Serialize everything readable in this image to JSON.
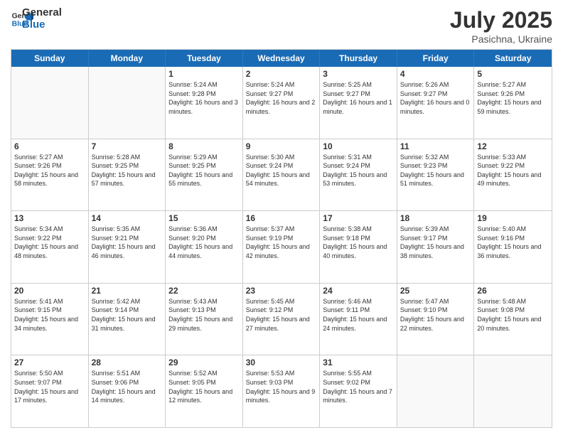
{
  "logo": {
    "line1": "General",
    "line2": "Blue"
  },
  "title": "July 2025",
  "subtitle": "Pasichna, Ukraine",
  "header_days": [
    "Sunday",
    "Monday",
    "Tuesday",
    "Wednesday",
    "Thursday",
    "Friday",
    "Saturday"
  ],
  "weeks": [
    [
      {
        "day": "",
        "sunrise": "",
        "sunset": "",
        "daylight": ""
      },
      {
        "day": "",
        "sunrise": "",
        "sunset": "",
        "daylight": ""
      },
      {
        "day": "1",
        "sunrise": "Sunrise: 5:24 AM",
        "sunset": "Sunset: 9:28 PM",
        "daylight": "Daylight: 16 hours and 3 minutes."
      },
      {
        "day": "2",
        "sunrise": "Sunrise: 5:24 AM",
        "sunset": "Sunset: 9:27 PM",
        "daylight": "Daylight: 16 hours and 2 minutes."
      },
      {
        "day": "3",
        "sunrise": "Sunrise: 5:25 AM",
        "sunset": "Sunset: 9:27 PM",
        "daylight": "Daylight: 16 hours and 1 minute."
      },
      {
        "day": "4",
        "sunrise": "Sunrise: 5:26 AM",
        "sunset": "Sunset: 9:27 PM",
        "daylight": "Daylight: 16 hours and 0 minutes."
      },
      {
        "day": "5",
        "sunrise": "Sunrise: 5:27 AM",
        "sunset": "Sunset: 9:26 PM",
        "daylight": "Daylight: 15 hours and 59 minutes."
      }
    ],
    [
      {
        "day": "6",
        "sunrise": "Sunrise: 5:27 AM",
        "sunset": "Sunset: 9:26 PM",
        "daylight": "Daylight: 15 hours and 58 minutes."
      },
      {
        "day": "7",
        "sunrise": "Sunrise: 5:28 AM",
        "sunset": "Sunset: 9:25 PM",
        "daylight": "Daylight: 15 hours and 57 minutes."
      },
      {
        "day": "8",
        "sunrise": "Sunrise: 5:29 AM",
        "sunset": "Sunset: 9:25 PM",
        "daylight": "Daylight: 15 hours and 55 minutes."
      },
      {
        "day": "9",
        "sunrise": "Sunrise: 5:30 AM",
        "sunset": "Sunset: 9:24 PM",
        "daylight": "Daylight: 15 hours and 54 minutes."
      },
      {
        "day": "10",
        "sunrise": "Sunrise: 5:31 AM",
        "sunset": "Sunset: 9:24 PM",
        "daylight": "Daylight: 15 hours and 53 minutes."
      },
      {
        "day": "11",
        "sunrise": "Sunrise: 5:32 AM",
        "sunset": "Sunset: 9:23 PM",
        "daylight": "Daylight: 15 hours and 51 minutes."
      },
      {
        "day": "12",
        "sunrise": "Sunrise: 5:33 AM",
        "sunset": "Sunset: 9:22 PM",
        "daylight": "Daylight: 15 hours and 49 minutes."
      }
    ],
    [
      {
        "day": "13",
        "sunrise": "Sunrise: 5:34 AM",
        "sunset": "Sunset: 9:22 PM",
        "daylight": "Daylight: 15 hours and 48 minutes."
      },
      {
        "day": "14",
        "sunrise": "Sunrise: 5:35 AM",
        "sunset": "Sunset: 9:21 PM",
        "daylight": "Daylight: 15 hours and 46 minutes."
      },
      {
        "day": "15",
        "sunrise": "Sunrise: 5:36 AM",
        "sunset": "Sunset: 9:20 PM",
        "daylight": "Daylight: 15 hours and 44 minutes."
      },
      {
        "day": "16",
        "sunrise": "Sunrise: 5:37 AM",
        "sunset": "Sunset: 9:19 PM",
        "daylight": "Daylight: 15 hours and 42 minutes."
      },
      {
        "day": "17",
        "sunrise": "Sunrise: 5:38 AM",
        "sunset": "Sunset: 9:18 PM",
        "daylight": "Daylight: 15 hours and 40 minutes."
      },
      {
        "day": "18",
        "sunrise": "Sunrise: 5:39 AM",
        "sunset": "Sunset: 9:17 PM",
        "daylight": "Daylight: 15 hours and 38 minutes."
      },
      {
        "day": "19",
        "sunrise": "Sunrise: 5:40 AM",
        "sunset": "Sunset: 9:16 PM",
        "daylight": "Daylight: 15 hours and 36 minutes."
      }
    ],
    [
      {
        "day": "20",
        "sunrise": "Sunrise: 5:41 AM",
        "sunset": "Sunset: 9:15 PM",
        "daylight": "Daylight: 15 hours and 34 minutes."
      },
      {
        "day": "21",
        "sunrise": "Sunrise: 5:42 AM",
        "sunset": "Sunset: 9:14 PM",
        "daylight": "Daylight: 15 hours and 31 minutes."
      },
      {
        "day": "22",
        "sunrise": "Sunrise: 5:43 AM",
        "sunset": "Sunset: 9:13 PM",
        "daylight": "Daylight: 15 hours and 29 minutes."
      },
      {
        "day": "23",
        "sunrise": "Sunrise: 5:45 AM",
        "sunset": "Sunset: 9:12 PM",
        "daylight": "Daylight: 15 hours and 27 minutes."
      },
      {
        "day": "24",
        "sunrise": "Sunrise: 5:46 AM",
        "sunset": "Sunset: 9:11 PM",
        "daylight": "Daylight: 15 hours and 24 minutes."
      },
      {
        "day": "25",
        "sunrise": "Sunrise: 5:47 AM",
        "sunset": "Sunset: 9:10 PM",
        "daylight": "Daylight: 15 hours and 22 minutes."
      },
      {
        "day": "26",
        "sunrise": "Sunrise: 5:48 AM",
        "sunset": "Sunset: 9:08 PM",
        "daylight": "Daylight: 15 hours and 20 minutes."
      }
    ],
    [
      {
        "day": "27",
        "sunrise": "Sunrise: 5:50 AM",
        "sunset": "Sunset: 9:07 PM",
        "daylight": "Daylight: 15 hours and 17 minutes."
      },
      {
        "day": "28",
        "sunrise": "Sunrise: 5:51 AM",
        "sunset": "Sunset: 9:06 PM",
        "daylight": "Daylight: 15 hours and 14 minutes."
      },
      {
        "day": "29",
        "sunrise": "Sunrise: 5:52 AM",
        "sunset": "Sunset: 9:05 PM",
        "daylight": "Daylight: 15 hours and 12 minutes."
      },
      {
        "day": "30",
        "sunrise": "Sunrise: 5:53 AM",
        "sunset": "Sunset: 9:03 PM",
        "daylight": "Daylight: 15 hours and 9 minutes."
      },
      {
        "day": "31",
        "sunrise": "Sunrise: 5:55 AM",
        "sunset": "Sunset: 9:02 PM",
        "daylight": "Daylight: 15 hours and 7 minutes."
      },
      {
        "day": "",
        "sunrise": "",
        "sunset": "",
        "daylight": ""
      },
      {
        "day": "",
        "sunrise": "",
        "sunset": "",
        "daylight": ""
      }
    ]
  ]
}
